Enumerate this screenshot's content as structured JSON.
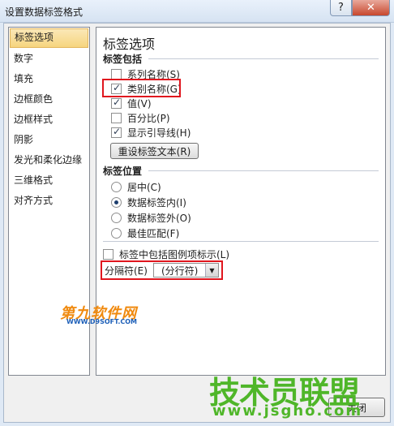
{
  "window": {
    "title": "设置数据标签格式",
    "help_label": "?",
    "close_label": "✕"
  },
  "nav": {
    "items": [
      "标签选项",
      "数字",
      "填充",
      "边框颜色",
      "边框样式",
      "阴影",
      "发光和柔化边缘",
      "三维格式",
      "对齐方式"
    ]
  },
  "panel": {
    "heading": "标签选项",
    "section_contains": "标签包括",
    "options": [
      {
        "label": "系列名称(S)",
        "checked": false
      },
      {
        "label": "类别名称(G)",
        "checked": true
      },
      {
        "label": "值(V)",
        "checked": true
      },
      {
        "label": "百分比(P)",
        "checked": false
      },
      {
        "label": "显示引导线(H)",
        "checked": true
      }
    ],
    "reset_button": "重设标签文本(R)",
    "section_position": "标签位置",
    "positions": [
      {
        "label": "居中(C)",
        "checked": false
      },
      {
        "label": "数据标签内(I)",
        "checked": true
      },
      {
        "label": "数据标签外(O)",
        "checked": false
      },
      {
        "label": "最佳匹配(F)",
        "checked": false
      }
    ],
    "legend_key_label": "标签中包括图例项标示(L)",
    "separator_label": "分隔符(E)",
    "separator_value": "(分行符)"
  },
  "footer": {
    "close_label": "关闭"
  },
  "watermarks": {
    "wm1": "第九软件网",
    "wm2": "WWW.D9SOFT.COM",
    "wm3": "技术员联盟",
    "wm4": "www.jsgho.com"
  },
  "colors": {
    "highlight_box": "#e0161e",
    "selected_nav": "#f6d57f"
  }
}
